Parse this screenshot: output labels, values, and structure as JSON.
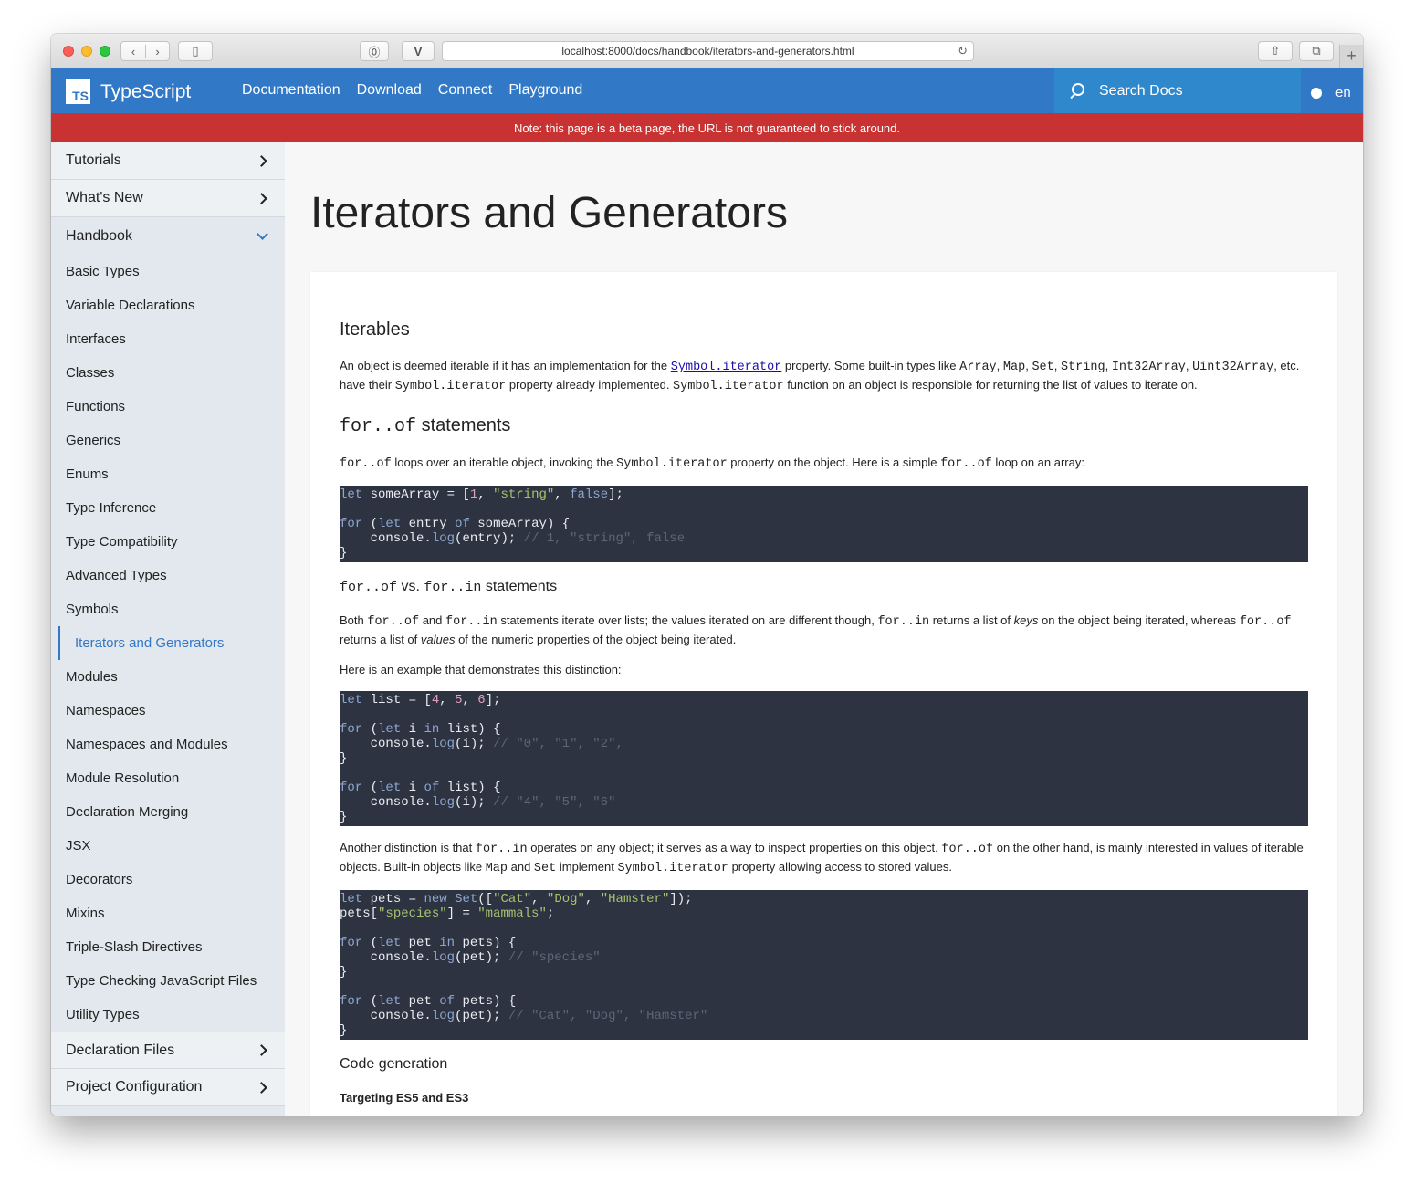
{
  "browser": {
    "url": "localhost:8000/docs/handbook/iterators-and-generators.html"
  },
  "topnav": {
    "logo_mark": "TS",
    "logo_text": "TypeScript",
    "links": [
      "Documentation",
      "Download",
      "Connect",
      "Playground"
    ],
    "search_placeholder": "Search Docs",
    "lang": "en"
  },
  "banner": "Note: this page is a beta page, the URL is not guaranteed to stick around.",
  "sidebar": {
    "sections_before": [
      "Tutorials",
      "What's New"
    ],
    "open_section": "Handbook",
    "items": [
      "Basic Types",
      "Variable Declarations",
      "Interfaces",
      "Classes",
      "Functions",
      "Generics",
      "Enums",
      "Type Inference",
      "Type Compatibility",
      "Advanced Types",
      "Symbols",
      "Iterators and Generators",
      "Modules",
      "Namespaces",
      "Namespaces and Modules",
      "Module Resolution",
      "Declaration Merging",
      "JSX",
      "Decorators",
      "Mixins",
      "Triple-Slash Directives",
      "Type Checking JavaScript Files",
      "Utility Types"
    ],
    "active_item": "Iterators and Generators",
    "sections_after": [
      "Declaration Files",
      "Project Configuration"
    ]
  },
  "content": {
    "title": "Iterators and Generators",
    "h_iterables": "Iterables",
    "p1": {
      "t1": "An object is deemed iterable if it has an implementation for the ",
      "link": "Symbol.iterator",
      "t2": " property. Some built-in types like ",
      "c1": "Array",
      "s1": ", ",
      "c2": "Map",
      "s2": ", ",
      "c3": "Set",
      "s3": ", ",
      "c4": "String",
      "s4": ", ",
      "c5": "Int32Array",
      "s5": ", ",
      "c6": "Uint32Array",
      "t3": ", etc. have their ",
      "c7": "Symbol.iterator",
      "t4": " property already implemented. ",
      "c8": "Symbol.iterator",
      "t5": " function on an object is responsible for returning the list of values to iterate on."
    },
    "h_forof": {
      "code": "for..of",
      "text": " statements"
    },
    "p2": {
      "c1": "for..of",
      "t1": " loops over an iterable object, invoking the ",
      "c2": "Symbol.iterator",
      "t2": " property on the object. Here is a simple ",
      "c3": "for..of",
      "t3": " loop on an array:"
    },
    "h_vs": {
      "c1": "for..of",
      "t1": " vs. ",
      "c2": "for..in",
      "t2": " statements"
    },
    "p3": {
      "t1": "Both ",
      "c1": "for..of",
      "t2": " and ",
      "c2": "for..in",
      "t3": " statements iterate over lists; the values iterated on are different though, ",
      "c3": "for..in",
      "t4": " returns a list of ",
      "em1": "keys",
      "t5": " on the object being iterated, whereas ",
      "c4": "for..of",
      "t6": " returns a list of ",
      "em2": "values",
      "t7": " of the numeric properties of the object being iterated."
    },
    "p4": "Here is an example that demonstrates this distinction:",
    "p5": {
      "t1": "Another distinction is that ",
      "c1": "for..in",
      "t2": " operates on any object; it serves as a way to inspect properties on this object. ",
      "c2": "for..of",
      "t3": " on the other hand, is mainly interested in values of iterable objects. Built-in objects like ",
      "c3": "Map",
      "t4": " and ",
      "c4": "Set",
      "t5": " implement ",
      "c5": "Symbol.iterator",
      "t6": " property allowing access to stored values."
    },
    "h_codegen": "Code generation",
    "h_targeting": "Targeting ES5 and ES3"
  },
  "code_blocks": [
    {
      "tokens": [
        [
          [
            "kw",
            "let"
          ],
          [
            "p",
            " someArray = ["
          ],
          [
            "num",
            "1"
          ],
          [
            "p",
            ", "
          ],
          [
            "str",
            "\"string\""
          ],
          [
            "p",
            ", "
          ],
          [
            "kw",
            "false"
          ],
          [
            "p",
            "];"
          ]
        ],
        [],
        [
          [
            "kw",
            "for"
          ],
          [
            "p",
            " ("
          ],
          [
            "kw",
            "let"
          ],
          [
            "p",
            " entry "
          ],
          [
            "kw",
            "of"
          ],
          [
            "p",
            " someArray) {"
          ]
        ],
        [
          [
            "p",
            "    console."
          ],
          [
            "kw",
            "log"
          ],
          [
            "p",
            "(entry); "
          ],
          [
            "cm",
            "// 1, \"string\", false"
          ]
        ],
        [
          [
            "p",
            "}"
          ]
        ]
      ]
    },
    {
      "tokens": [
        [
          [
            "kw",
            "let"
          ],
          [
            "p",
            " list = ["
          ],
          [
            "num",
            "4"
          ],
          [
            "p",
            ", "
          ],
          [
            "num",
            "5"
          ],
          [
            "p",
            ", "
          ],
          [
            "num",
            "6"
          ],
          [
            "p",
            "];"
          ]
        ],
        [],
        [
          [
            "kw",
            "for"
          ],
          [
            "p",
            " ("
          ],
          [
            "kw",
            "let"
          ],
          [
            "p",
            " i "
          ],
          [
            "kw",
            "in"
          ],
          [
            "p",
            " list) {"
          ]
        ],
        [
          [
            "p",
            "    console."
          ],
          [
            "kw",
            "log"
          ],
          [
            "p",
            "(i); "
          ],
          [
            "cm",
            "// \"0\", \"1\", \"2\","
          ]
        ],
        [
          [
            "p",
            "}"
          ]
        ],
        [],
        [
          [
            "kw",
            "for"
          ],
          [
            "p",
            " ("
          ],
          [
            "kw",
            "let"
          ],
          [
            "p",
            " i "
          ],
          [
            "kw",
            "of"
          ],
          [
            "p",
            " list) {"
          ]
        ],
        [
          [
            "p",
            "    console."
          ],
          [
            "kw",
            "log"
          ],
          [
            "p",
            "(i); "
          ],
          [
            "cm",
            "// \"4\", \"5\", \"6\""
          ]
        ],
        [
          [
            "p",
            "}"
          ]
        ]
      ]
    },
    {
      "tokens": [
        [
          [
            "kw",
            "let"
          ],
          [
            "p",
            " pets = "
          ],
          [
            "kw",
            "new"
          ],
          [
            "p",
            " "
          ],
          [
            "kw",
            "Set"
          ],
          [
            "p",
            "(["
          ],
          [
            "str",
            "\"Cat\""
          ],
          [
            "p",
            ", "
          ],
          [
            "str",
            "\"Dog\""
          ],
          [
            "p",
            ", "
          ],
          [
            "str",
            "\"Hamster\""
          ],
          [
            "p",
            "]);"
          ]
        ],
        [
          [
            "p",
            "pets["
          ],
          [
            "str",
            "\"species\""
          ],
          [
            "p",
            "] = "
          ],
          [
            "str",
            "\"mammals\""
          ],
          [
            "p",
            ";"
          ]
        ],
        [],
        [
          [
            "kw",
            "for"
          ],
          [
            "p",
            " ("
          ],
          [
            "kw",
            "let"
          ],
          [
            "p",
            " pet "
          ],
          [
            "kw",
            "in"
          ],
          [
            "p",
            " pets) {"
          ]
        ],
        [
          [
            "p",
            "    console."
          ],
          [
            "kw",
            "log"
          ],
          [
            "p",
            "(pet); "
          ],
          [
            "cm",
            "// \"species\""
          ]
        ],
        [
          [
            "p",
            "}"
          ]
        ],
        [],
        [
          [
            "kw",
            "for"
          ],
          [
            "p",
            " ("
          ],
          [
            "kw",
            "let"
          ],
          [
            "p",
            " pet "
          ],
          [
            "kw",
            "of"
          ],
          [
            "p",
            " pets) {"
          ]
        ],
        [
          [
            "p",
            "    console."
          ],
          [
            "kw",
            "log"
          ],
          [
            "p",
            "(pet); "
          ],
          [
            "cm",
            "// \"Cat\", \"Dog\", \"Hamster\""
          ]
        ],
        [
          [
            "p",
            "}"
          ]
        ]
      ]
    }
  ],
  "colors": {
    "brand": "#3178c6",
    "banner": "#c83232",
    "code_bg": "#2d3340"
  }
}
